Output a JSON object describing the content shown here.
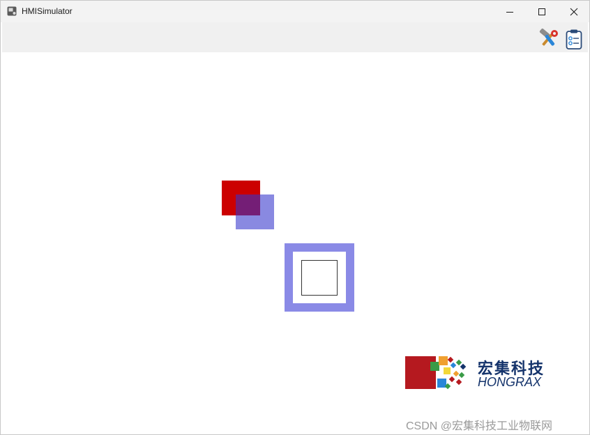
{
  "window": {
    "title": "HMISimulator",
    "icons": {
      "app": "app-icon",
      "minimize": "minimize-icon",
      "maximize": "maximize-icon",
      "close": "close-icon"
    }
  },
  "toolbar": {
    "buttons": [
      {
        "icon": "hammer-wrench-icon"
      },
      {
        "icon": "clipboard-checklist-icon"
      }
    ]
  },
  "canvas": {
    "background": "#ffffff",
    "shapes": [
      {
        "kind": "rectangle",
        "fill": "#cc0000"
      },
      {
        "kind": "rectangle",
        "fill": "#3333cc",
        "opacity": 0.58
      },
      {
        "kind": "square-frame",
        "border_color": "#8a8ae6",
        "inner_outline": "#333333"
      }
    ]
  },
  "logo": {
    "name_cn": "宏集科技",
    "name_en": "HONGRAX",
    "color": "#14336b"
  },
  "watermark": "CSDN @宏集科技工业物联网"
}
